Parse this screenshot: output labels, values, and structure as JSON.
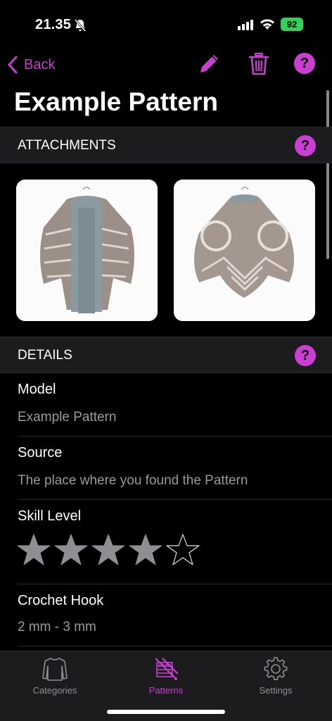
{
  "status": {
    "time": "21.35",
    "battery": "92"
  },
  "nav": {
    "back_label": "Back"
  },
  "page": {
    "title": "Example Pattern"
  },
  "attachments": {
    "header": "ATTACHMENTS"
  },
  "details": {
    "header": "DETAILS",
    "model_title": "Model",
    "model_value": "Example Pattern",
    "source_title": "Source",
    "source_value": "The place where you found the Pattern",
    "skill_title": "Skill Level",
    "skill_rating": 4,
    "skill_max": 5,
    "hook_title": "Crochet Hook",
    "hook_value": "2 mm - 3 mm"
  },
  "tabs": [
    {
      "label": "Categories",
      "icon": "sweater-icon"
    },
    {
      "label": "Patterns",
      "icon": "knitting-icon"
    },
    {
      "label": "Settings",
      "icon": "gear-icon"
    }
  ],
  "colors": {
    "accent": "#c83fd1",
    "background": "#000000",
    "section": "#1c1c1e"
  }
}
